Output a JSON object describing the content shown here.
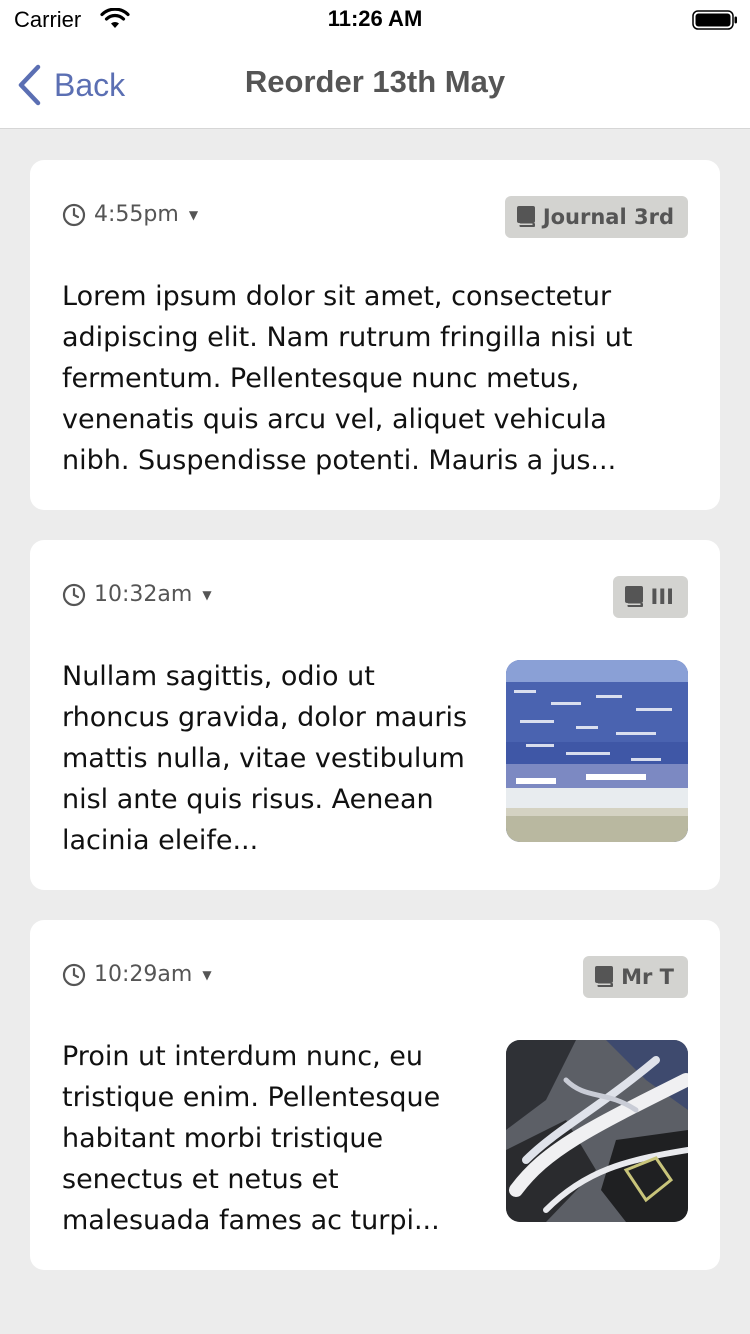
{
  "status_bar": {
    "carrier": "Carrier",
    "time": "11:26 AM"
  },
  "nav": {
    "back_label": "Back",
    "title": "Reorder 13th May"
  },
  "entries": [
    {
      "time": "4:55pm",
      "journal": "Journal 3rd",
      "text": "Lorem ipsum dolor sit amet, consectetur adipiscing elit. Nam rutrum fringilla nisi ut fermentum. Pellentesque nunc metus, venenatis quis arcu vel, aliquet vehicula nibh. Suspendisse potenti. Mauris a jus...",
      "has_image": false
    },
    {
      "time": "10:32am",
      "journal": "III",
      "text": "Nullam sagittis, odio ut rhoncus gravida, dolor mauris mattis nulla, vitae vestibulum nisl ante quis risus. Aenean lacinia eleife...",
      "has_image": true,
      "image": "ocean-photo"
    },
    {
      "time": "10:29am",
      "journal": "Mr T",
      "text": "Proin ut interdum nunc, eu tristique enim. Pellentesque habitant morbi tristique senectus et netus et malesuada fames ac turpi...",
      "has_image": true,
      "image": "abstract-photo"
    }
  ],
  "colors": {
    "accent": "#5b6fb3",
    "background": "#ececec",
    "badge": "#d3d3d0"
  }
}
